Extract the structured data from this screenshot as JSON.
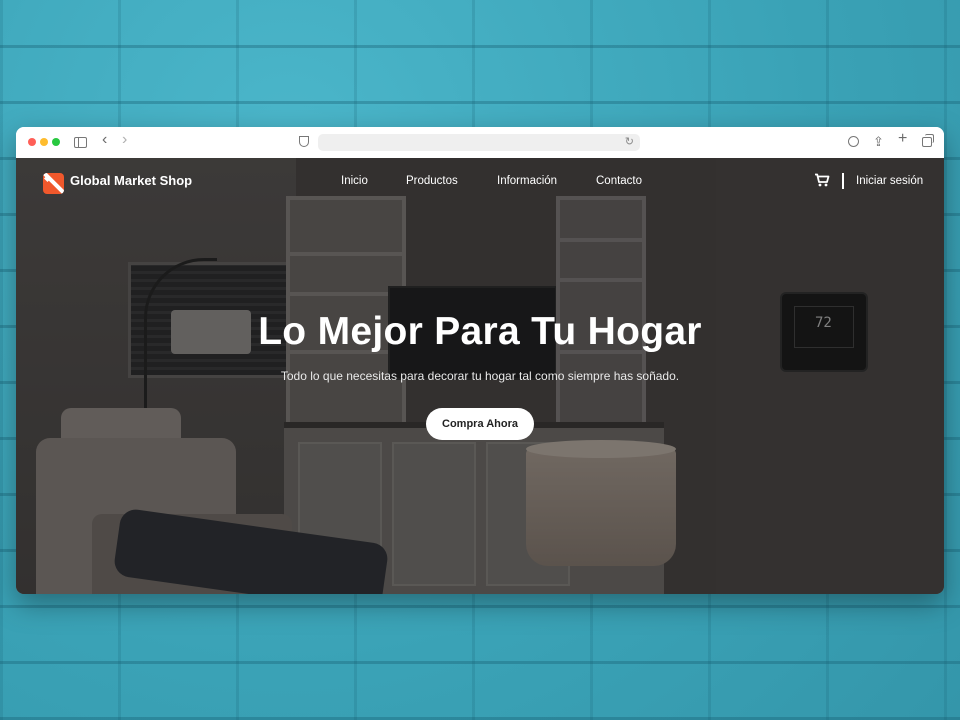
{
  "browser": {
    "url": ""
  },
  "site": {
    "logo_text": "Global Market Shop",
    "nav": [
      {
        "label": "Inicio"
      },
      {
        "label": "Productos"
      },
      {
        "label": "Información"
      },
      {
        "label": "Contacto"
      }
    ],
    "login_label": "Iniciar sesión",
    "brand_color": "#f0582c"
  },
  "hero": {
    "title": "Lo Mejor Para Tu Hogar",
    "subtitle": "Todo lo que necesitas para decorar tu hogar tal como siempre has soñado.",
    "cta_label": "Compra Ahora",
    "thermostat_reading": "72"
  }
}
